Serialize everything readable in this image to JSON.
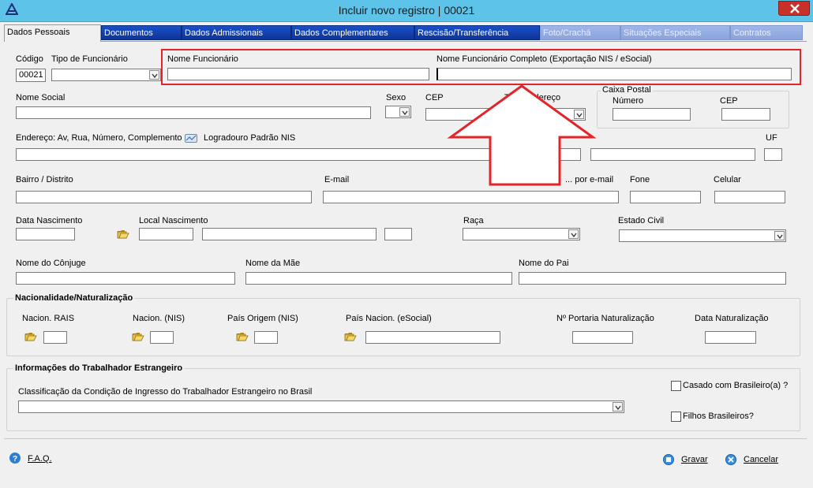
{
  "window": {
    "title": "Incluir novo registro | 00021",
    "close_glyph": "×"
  },
  "tabs": [
    {
      "label": "Dados Pessoais",
      "state": "active"
    },
    {
      "label": "Documentos",
      "state": "normal"
    },
    {
      "label": "Dados Admissionais",
      "state": "normal"
    },
    {
      "label": "Dados Complementares",
      "state": "normal"
    },
    {
      "label": "Rescisão/Transferência",
      "state": "normal"
    },
    {
      "label": "Foto/Crachá",
      "state": "disabled"
    },
    {
      "label": "Situações Especiais",
      "state": "disabled"
    },
    {
      "label": "Contratos",
      "state": "disabled"
    }
  ],
  "form": {
    "codigo": {
      "label": "Código",
      "value": "00021"
    },
    "tipo_funcionario": {
      "label": "Tipo de Funcionário",
      "value": ""
    },
    "nome_funcionario": {
      "label": "Nome Funcionário",
      "value": ""
    },
    "nome_completo": {
      "label": "Nome Funcionário Completo (Exportação NIS / eSocial)",
      "value": ""
    },
    "nome_social": {
      "label": "Nome Social",
      "value": ""
    },
    "sexo": {
      "label": "Sexo",
      "value": ""
    },
    "cep": {
      "label": "CEP",
      "value": ""
    },
    "tipo_endereco": {
      "label": "Tipo Endereço",
      "value": ""
    },
    "caixa_postal": {
      "title": "Caixa Postal",
      "numero_label": "Número",
      "cep_label": "CEP"
    },
    "endereco": {
      "label": "Endereço: Av, Rua, Número, Complemento",
      "logradouro_label": "Logradouro Padrão NIS"
    },
    "uf": {
      "label": "UF"
    },
    "bairro": {
      "label": "Bairro / Distrito"
    },
    "email": {
      "label": "E-mail"
    },
    "email_option": {
      "label": "... por e-mail"
    },
    "fone": {
      "label": "Fone"
    },
    "celular": {
      "label": "Celular"
    },
    "data_nascimento": {
      "label": "Data Nascimento"
    },
    "local_nascimento": {
      "label": "Local Nascimento"
    },
    "raca": {
      "label": "Raça"
    },
    "estado_civil": {
      "label": "Estado Civil"
    },
    "conjuge": {
      "label": "Nome do Cônjuge"
    },
    "mae": {
      "label": "Nome da Mãe"
    },
    "pai": {
      "label": "Nome do Pai"
    }
  },
  "nacionalidade": {
    "title": "Nacionalidade/Naturalização",
    "rais": "Nacion. RAIS",
    "nis": "Nacion. (NIS)",
    "pais_origem": "País Origem (NIS)",
    "pais_esocial": "País Nacion. (eSocial)",
    "portaria": "Nº Portaria Naturalização",
    "data": "Data Naturalização"
  },
  "estrangeiro": {
    "title": "Informações do Trabalhador Estrangeiro",
    "classificacao": "Classificação da Condição de Ingresso do Trabalhador Estrangeiro no Brasil",
    "casado": "Casado com Brasileiro(a) ?",
    "filhos": "Filhos Brasileiros?"
  },
  "footer": {
    "faq": "F.A.Q.",
    "gravar": "Gravar",
    "cancelar": "Cancelar"
  },
  "colors": {
    "titlebar": "#5ec3e9",
    "tab_active": "#f0f0f0",
    "tab_normal": "#1a4fc9",
    "highlight": "#e3242b"
  },
  "icons": [
    "app-icon",
    "close-icon",
    "folder-icon",
    "search-address-icon",
    "help-icon",
    "save-icon",
    "cancel-icon",
    "annotation-arrow"
  ]
}
